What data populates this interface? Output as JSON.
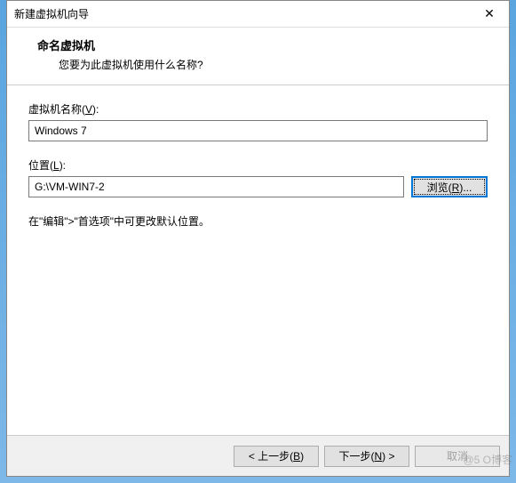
{
  "window": {
    "title": "新建虚拟机向导",
    "close_label": "✕"
  },
  "header": {
    "title": "命名虚拟机",
    "subtitle": "您要为此虚拟机使用什么名称?"
  },
  "fields": {
    "name_label_pre": "虚拟机名称(",
    "name_label_u": "V",
    "name_label_post": "):",
    "name_value": "Windows 7",
    "location_label_pre": "位置(",
    "location_label_u": "L",
    "location_label_post": "):",
    "location_value": "G:\\VM-WIN7-2",
    "browse_pre": "浏览(",
    "browse_u": "R",
    "browse_post": ")..."
  },
  "hint": "在\"编辑\">\"首选项\"中可更改默认位置。",
  "footer": {
    "back_pre": "< 上一步(",
    "back_u": "B",
    "back_post": ")",
    "next_pre": "下一步(",
    "next_u": "N",
    "next_post": ") >",
    "cancel": "取消"
  },
  "watermark": "@5 O博客"
}
